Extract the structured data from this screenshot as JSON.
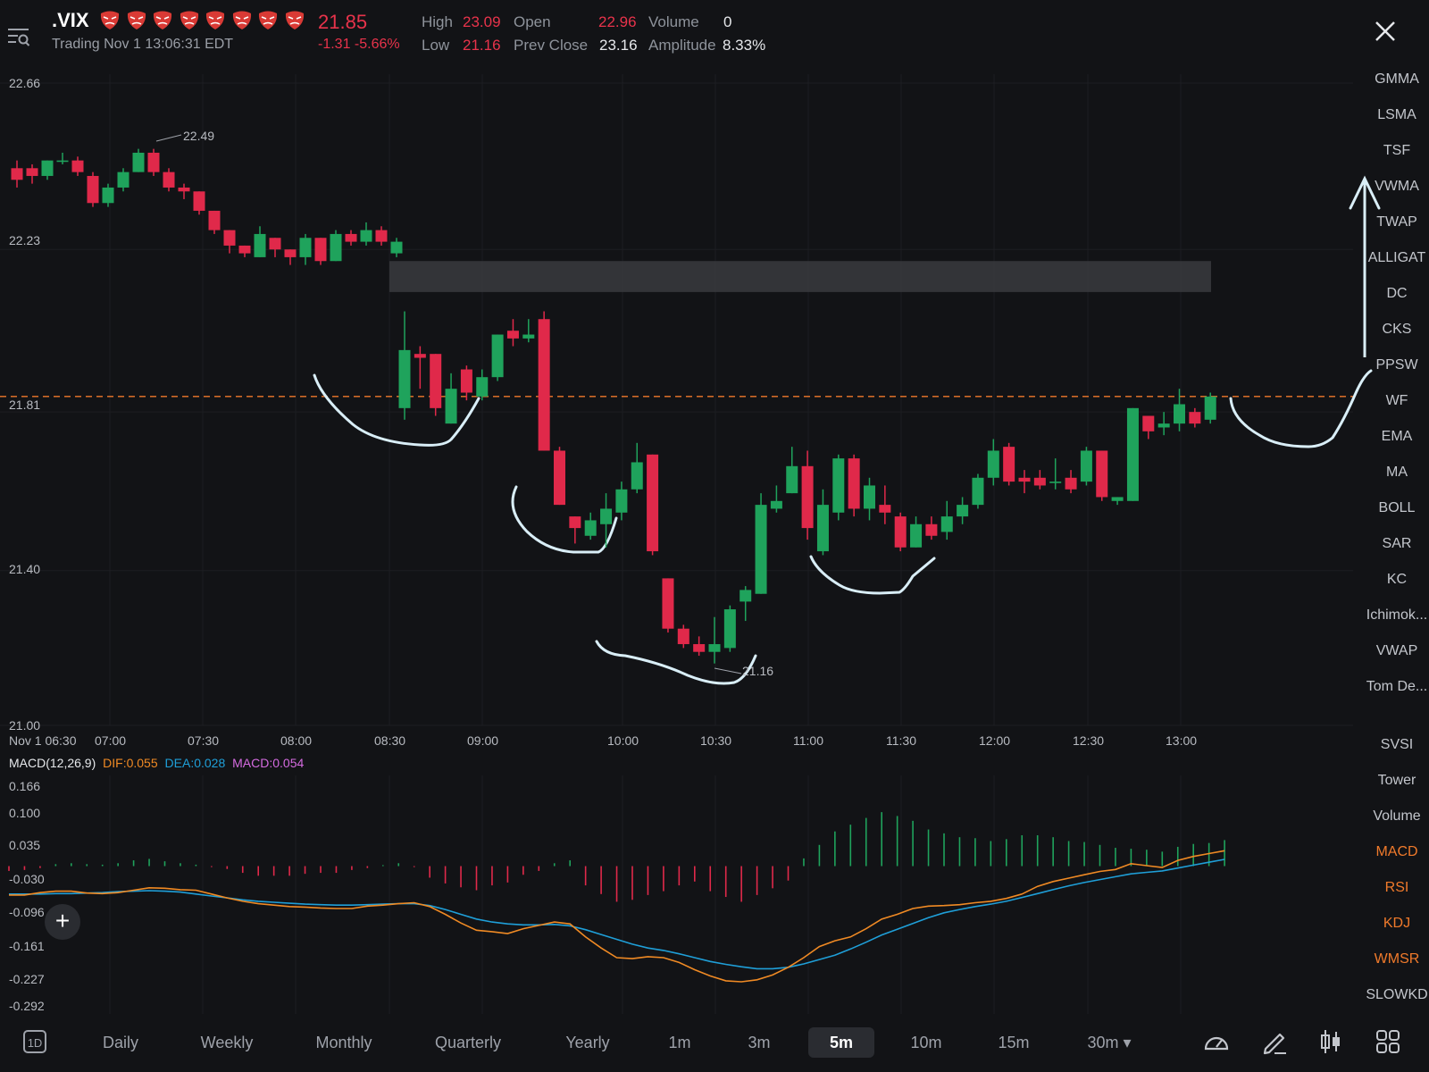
{
  "header": {
    "ticker": ".VIX",
    "sentiment_icons": [
      "red-mask-icon",
      "red-mask-icon",
      "red-mask-icon",
      "red-mask-icon",
      "red-mask-icon",
      "red-mask-icon",
      "red-mask-icon",
      "red-mask-icon"
    ],
    "status": "Trading Nov 1 13:06:31 EDT",
    "price": "21.85",
    "change": "-1.31 -5.66%",
    "stats": {
      "high_label": "High",
      "high": "23.09",
      "low_label": "Low",
      "low": "21.16",
      "open_label": "Open",
      "open": "22.96",
      "prev_close_label": "Prev Close",
      "prev_close": "23.16",
      "volume_label": "Volume",
      "volume": "0",
      "amplitude_label": "Amplitude",
      "amplitude": "8.33%"
    }
  },
  "indicators_main": [
    "GMMA",
    "LSMA",
    "TSF",
    "VWMA",
    "TWAP",
    "ALLIGAT",
    "DC",
    "CKS",
    "PPSW",
    "WF",
    "EMA",
    "MA",
    "BOLL",
    "SAR",
    "KC",
    "Ichimok...",
    "VWAP",
    "Tom De..."
  ],
  "indicators_sub": [
    {
      "label": "SVSI",
      "active": false
    },
    {
      "label": "Tower",
      "active": false
    },
    {
      "label": "Volume",
      "active": false
    },
    {
      "label": "MACD",
      "active": true
    },
    {
      "label": "RSI",
      "active": true
    },
    {
      "label": "KDJ",
      "active": true
    },
    {
      "label": "WMSR",
      "active": true
    },
    {
      "label": "SLOWKD",
      "active": false
    }
  ],
  "macd_legend": {
    "title": "MACD(12,26,9)",
    "dif": "DIF:0.055",
    "dea": "DEA:0.028",
    "macd": "MACD:0.054"
  },
  "bottom_bar": {
    "period_icon_label": "1D",
    "timeframes": [
      "Daily",
      "Weekly",
      "Monthly",
      "Quarterly",
      "Yearly",
      "1m",
      "3m",
      "5m",
      "10m",
      "15m",
      "30m"
    ],
    "selected": "5m"
  },
  "colors": {
    "up": "#1fa35c",
    "down": "#e0294a",
    "dif": "#f08a24",
    "dea": "#1f9fd8",
    "macd_label": "#d56be0",
    "price_line": "#f07a2b",
    "drawing": "#d9eef7"
  },
  "chart_data": [
    {
      "type": "candlestick",
      "y_ticks": [
        "22.66",
        "22.23",
        "21.81",
        "21.40",
        "21.00"
      ],
      "ylim": [
        21.0,
        22.66
      ],
      "x_ticks": [
        "Nov 1 06:30",
        "07:00",
        "07:30",
        "08:00",
        "08:30",
        "09:00",
        "10:00",
        "10:30",
        "11:00",
        "11:30",
        "12:00",
        "12:30",
        "13:00"
      ],
      "high_annotation": "22.49",
      "low_annotation": "21.16",
      "current_price_line": 21.85,
      "candles": [
        [
          22.44,
          22.41,
          22.46,
          22.39
        ],
        [
          22.44,
          22.42,
          22.45,
          22.4
        ],
        [
          22.42,
          22.46,
          22.46,
          22.41
        ],
        [
          22.46,
          22.46,
          22.48,
          22.45
        ],
        [
          22.46,
          22.43,
          22.47,
          22.42
        ],
        [
          22.42,
          22.35,
          22.43,
          22.34
        ],
        [
          22.35,
          22.39,
          22.4,
          22.34
        ],
        [
          22.39,
          22.43,
          22.44,
          22.38
        ],
        [
          22.43,
          22.48,
          22.49,
          22.43
        ],
        [
          22.48,
          22.43,
          22.49,
          22.42
        ],
        [
          22.43,
          22.39,
          22.44,
          22.38
        ],
        [
          22.39,
          22.38,
          22.4,
          22.36
        ],
        [
          22.38,
          22.33,
          22.38,
          22.32
        ],
        [
          22.33,
          22.28,
          22.33,
          22.27
        ],
        [
          22.28,
          22.24,
          22.28,
          22.22
        ],
        [
          22.24,
          22.22,
          22.24,
          22.21
        ],
        [
          22.21,
          22.27,
          22.29,
          22.21
        ],
        [
          22.26,
          22.23,
          22.26,
          22.21
        ],
        [
          22.23,
          22.21,
          22.23,
          22.19
        ],
        [
          22.21,
          22.26,
          22.27,
          22.19
        ],
        [
          22.26,
          22.2,
          22.26,
          22.19
        ],
        [
          22.2,
          22.27,
          22.28,
          22.2
        ],
        [
          22.27,
          22.25,
          22.28,
          22.24
        ],
        [
          22.25,
          22.28,
          22.3,
          22.24
        ],
        [
          22.28,
          22.25,
          22.29,
          22.24
        ],
        [
          22.22,
          22.25,
          22.26,
          22.21
        ],
        [
          21.82,
          21.97,
          22.07,
          21.79
        ],
        [
          21.96,
          21.95,
          21.98,
          21.87
        ],
        [
          21.96,
          21.82,
          21.96,
          21.8
        ],
        [
          21.78,
          21.87,
          21.91,
          21.78
        ],
        [
          21.92,
          21.86,
          21.93,
          21.84
        ],
        [
          21.85,
          21.9,
          21.92,
          21.84
        ],
        [
          21.9,
          22.01,
          22.01,
          21.89
        ],
        [
          22.02,
          22.0,
          22.05,
          21.98
        ],
        [
          22.0,
          22.01,
          22.05,
          21.99
        ],
        [
          22.05,
          21.71,
          22.07,
          21.71
        ],
        [
          21.71,
          21.57,
          21.72,
          21.57
        ],
        [
          21.54,
          21.51,
          21.54,
          21.47
        ],
        [
          21.49,
          21.53,
          21.55,
          21.48
        ],
        [
          21.52,
          21.56,
          21.6,
          21.46
        ],
        [
          21.55,
          21.61,
          21.63,
          21.53
        ],
        [
          21.61,
          21.68,
          21.73,
          21.6
        ],
        [
          21.7,
          21.45,
          21.7,
          21.44
        ],
        [
          21.38,
          21.25,
          21.38,
          21.24
        ],
        [
          21.25,
          21.21,
          21.26,
          21.2
        ],
        [
          21.21,
          21.19,
          21.23,
          21.18
        ],
        [
          21.19,
          21.21,
          21.28,
          21.16
        ],
        [
          21.2,
          21.3,
          21.31,
          21.19
        ],
        [
          21.32,
          21.35,
          21.36,
          21.27
        ],
        [
          21.34,
          21.57,
          21.6,
          21.34
        ],
        [
          21.56,
          21.58,
          21.62,
          21.55
        ],
        [
          21.6,
          21.67,
          21.72,
          21.6
        ],
        [
          21.67,
          21.51,
          21.71,
          21.48
        ],
        [
          21.45,
          21.57,
          21.61,
          21.44
        ],
        [
          21.55,
          21.69,
          21.7,
          21.53
        ],
        [
          21.69,
          21.56,
          21.7,
          21.54
        ],
        [
          21.56,
          21.62,
          21.64,
          21.53
        ],
        [
          21.57,
          21.55,
          21.62,
          21.52
        ],
        [
          21.54,
          21.46,
          21.55,
          21.45
        ],
        [
          21.46,
          21.52,
          21.54,
          21.46
        ],
        [
          21.52,
          21.49,
          21.54,
          21.48
        ],
        [
          21.5,
          21.54,
          21.58,
          21.48
        ],
        [
          21.54,
          21.57,
          21.59,
          21.52
        ],
        [
          21.57,
          21.64,
          21.65,
          21.56
        ],
        [
          21.64,
          21.71,
          21.74,
          21.62
        ],
        [
          21.72,
          21.63,
          21.73,
          21.62
        ],
        [
          21.64,
          21.63,
          21.66,
          21.6
        ],
        [
          21.64,
          21.62,
          21.66,
          21.61
        ],
        [
          21.63,
          21.63,
          21.69,
          21.61
        ],
        [
          21.64,
          21.61,
          21.66,
          21.6
        ],
        [
          21.63,
          21.71,
          21.72,
          21.62
        ],
        [
          21.71,
          21.59,
          21.71,
          21.58
        ],
        [
          21.58,
          21.59,
          21.59,
          21.57
        ],
        [
          21.58,
          21.82,
          21.82,
          21.58
        ],
        [
          21.8,
          21.76,
          21.8,
          21.74
        ],
        [
          21.77,
          21.78,
          21.81,
          21.75
        ],
        [
          21.78,
          21.83,
          21.87,
          21.76
        ],
        [
          21.81,
          21.78,
          21.82,
          21.77
        ],
        [
          21.79,
          21.85,
          21.86,
          21.78
        ]
      ]
    },
    {
      "type": "macd",
      "y_ticks": [
        "0.166",
        "0.100",
        "0.035",
        "-0.030",
        "-0.096",
        "-0.161",
        "-0.227",
        "-0.292"
      ],
      "ylim": [
        -0.292,
        0.166
      ],
      "histogram": [
        -0.01,
        -0.008,
        -0.004,
        0.004,
        0.006,
        0.004,
        0.003,
        0.006,
        0.012,
        0.015,
        0.01,
        0.006,
        0.003,
        -0.002,
        -0.006,
        -0.014,
        -0.02,
        -0.02,
        -0.02,
        -0.016,
        -0.014,
        -0.014,
        -0.008,
        -0.004,
        0.002,
        0.006,
        -0.002,
        -0.024,
        -0.036,
        -0.044,
        -0.05,
        -0.04,
        -0.034,
        -0.018,
        -0.01,
        0.006,
        0.012,
        -0.04,
        -0.058,
        -0.074,
        -0.07,
        -0.06,
        -0.052,
        -0.04,
        -0.032,
        -0.052,
        -0.064,
        -0.074,
        -0.06,
        -0.046,
        -0.03,
        0.016,
        0.044,
        0.072,
        0.086,
        0.1,
        0.112,
        0.104,
        0.094,
        0.076,
        0.068,
        0.06,
        0.058,
        0.052,
        0.056,
        0.064,
        0.064,
        0.06,
        0.052,
        0.05,
        0.044,
        0.038,
        0.036,
        0.034,
        0.03,
        0.04,
        0.046,
        0.048,
        0.054
      ],
      "dif": [
        -0.06,
        -0.06,
        -0.055,
        -0.052,
        -0.052,
        -0.056,
        -0.057,
        -0.055,
        -0.05,
        -0.045,
        -0.046,
        -0.049,
        -0.05,
        -0.058,
        -0.066,
        -0.073,
        -0.078,
        -0.081,
        -0.084,
        -0.085,
        -0.087,
        -0.088,
        -0.088,
        -0.083,
        -0.081,
        -0.078,
        -0.076,
        -0.084,
        -0.1,
        -0.118,
        -0.133,
        -0.136,
        -0.14,
        -0.13,
        -0.123,
        -0.116,
        -0.12,
        -0.147,
        -0.17,
        -0.19,
        -0.192,
        -0.188,
        -0.19,
        -0.2,
        -0.215,
        -0.228,
        -0.238,
        -0.24,
        -0.236,
        -0.226,
        -0.21,
        -0.19,
        -0.167,
        -0.155,
        -0.147,
        -0.13,
        -0.11,
        -0.1,
        -0.088,
        -0.083,
        -0.082,
        -0.08,
        -0.076,
        -0.073,
        -0.067,
        -0.058,
        -0.042,
        -0.032,
        -0.025,
        -0.018,
        -0.011,
        -0.007,
        0.005,
        0.001,
        -0.003,
        0.012,
        0.02,
        0.026,
        0.032
      ],
      "dea": [
        -0.058,
        -0.058,
        -0.058,
        -0.057,
        -0.057,
        -0.056,
        -0.055,
        -0.053,
        -0.052,
        -0.051,
        -0.052,
        -0.054,
        -0.058,
        -0.062,
        -0.066,
        -0.07,
        -0.073,
        -0.075,
        -0.077,
        -0.079,
        -0.08,
        -0.081,
        -0.081,
        -0.08,
        -0.079,
        -0.078,
        -0.078,
        -0.082,
        -0.09,
        -0.1,
        -0.11,
        -0.116,
        -0.12,
        -0.122,
        -0.122,
        -0.121,
        -0.124,
        -0.132,
        -0.142,
        -0.152,
        -0.162,
        -0.17,
        -0.175,
        -0.182,
        -0.19,
        -0.198,
        -0.204,
        -0.209,
        -0.213,
        -0.213,
        -0.21,
        -0.203,
        -0.194,
        -0.185,
        -0.172,
        -0.158,
        -0.143,
        -0.131,
        -0.119,
        -0.107,
        -0.097,
        -0.09,
        -0.084,
        -0.079,
        -0.073,
        -0.065,
        -0.057,
        -0.049,
        -0.041,
        -0.034,
        -0.028,
        -0.022,
        -0.016,
        -0.013,
        -0.01,
        -0.004,
        0.002,
        0.008,
        0.014
      ],
      "dif_name": "DIF",
      "dea_name": "DEA"
    }
  ]
}
